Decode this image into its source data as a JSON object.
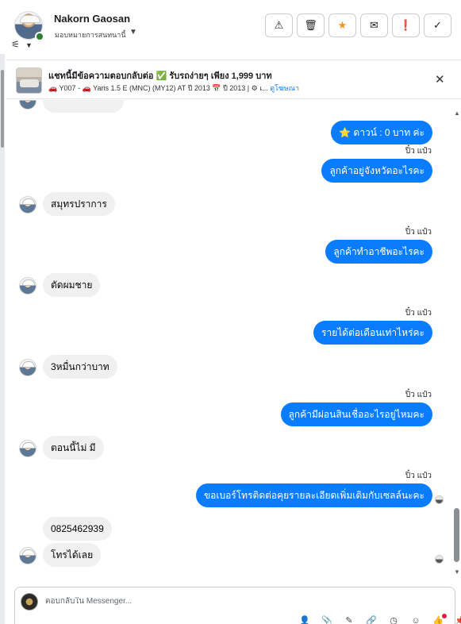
{
  "contact": {
    "name": "Nakorn Gaosan",
    "assign_label": "มอบหมายการสนทนานี้",
    "status_color": "#2e7d32"
  },
  "icons": {
    "filter": "⚟",
    "caret": "▼",
    "close": "✕"
  },
  "toolbar": [
    {
      "name": "spam-button",
      "icon": "⚠",
      "icon_name": "warning-icon"
    },
    {
      "name": "delete-button",
      "icon": "🗑",
      "icon_name": "trash-icon"
    },
    {
      "name": "star-button",
      "icon": "★",
      "icon_name": "star-icon"
    },
    {
      "name": "mail-button",
      "icon": "✉",
      "icon_name": "envelope-icon"
    },
    {
      "name": "follow-up-button",
      "icon": "❗",
      "icon_name": "follow-up-icon"
    },
    {
      "name": "done-button",
      "icon": "✓",
      "icon_name": "check-icon"
    }
  ],
  "ad": {
    "title": "แชทนี้มีข้อความตอบกลับต่อ ✅ รับรถง่ายๆ เพียง 1,999 บาท",
    "subtitle": "🚗 Y007 - 🚗 Yaris 1.5 E (MNC) (MY12) AT ปี 2013 📅 ปี 2013 | ⚙ เ... ",
    "link": "ดูโฆษณา"
  },
  "messages": [
    {
      "dir": "out",
      "text": "⭐ ดาวน์ : 0 บาท  ค่ะ"
    },
    {
      "dir": "sender",
      "text": "ปิ๋ว แป๋ว"
    },
    {
      "dir": "out",
      "text": "ลูกค้าอยู่จังหวัดอะไรคะ"
    },
    {
      "dir": "in",
      "text": "สมุทรปราการ"
    },
    {
      "dir": "sender",
      "text": "ปิ๋ว แป๋ว"
    },
    {
      "dir": "out",
      "text": "ลูกค้าทำอาชีพอะไรคะ"
    },
    {
      "dir": "in",
      "text": "ตัดผมชาย"
    },
    {
      "dir": "sender",
      "text": "ปิ๋ว แป๋ว"
    },
    {
      "dir": "out",
      "text": "รายได้ต่อเดือนเท่าไหร่คะ"
    },
    {
      "dir": "in",
      "text": "3หมื่นกว่าบาท"
    },
    {
      "dir": "sender",
      "text": "ปิ๋ว แป๋ว"
    },
    {
      "dir": "out",
      "text": "ลูกค้ามีผ่อนสินเชื่ออะไรอยู่ไหมคะ"
    },
    {
      "dir": "in",
      "text": "ตอนนี้ไม่ มี"
    },
    {
      "dir": "sender",
      "text": "ปิ๋ว แป๋ว"
    },
    {
      "dir": "out",
      "text": "ขอเบอร์โทรติดต่อคุยรายละเอียดเพิ่มเติมกับเซลล์นะคะ"
    },
    {
      "dir": "in",
      "text": "0825462939"
    },
    {
      "dir": "in",
      "text": "โทรได้เลย"
    }
  ],
  "composer": {
    "placeholder": "ตอบกลับใน Messenger...",
    "tools": [
      {
        "name": "add-person-icon",
        "glyph": "👤"
      },
      {
        "name": "attach-icon",
        "glyph": "📎"
      },
      {
        "name": "pen-icon",
        "glyph": "✎"
      },
      {
        "name": "link-icon",
        "glyph": "🔗"
      },
      {
        "name": "clock-icon",
        "glyph": "◷"
      },
      {
        "name": "emoji-icon",
        "glyph": "☺"
      },
      {
        "name": "like-icon",
        "glyph": "👍"
      },
      {
        "name": "pin-icon",
        "glyph": "📌"
      }
    ]
  },
  "colors": {
    "bubble_out": "#0a7cff",
    "bubble_in": "#f0f0f0",
    "star": "#f7931e",
    "link": "#1877f2"
  }
}
